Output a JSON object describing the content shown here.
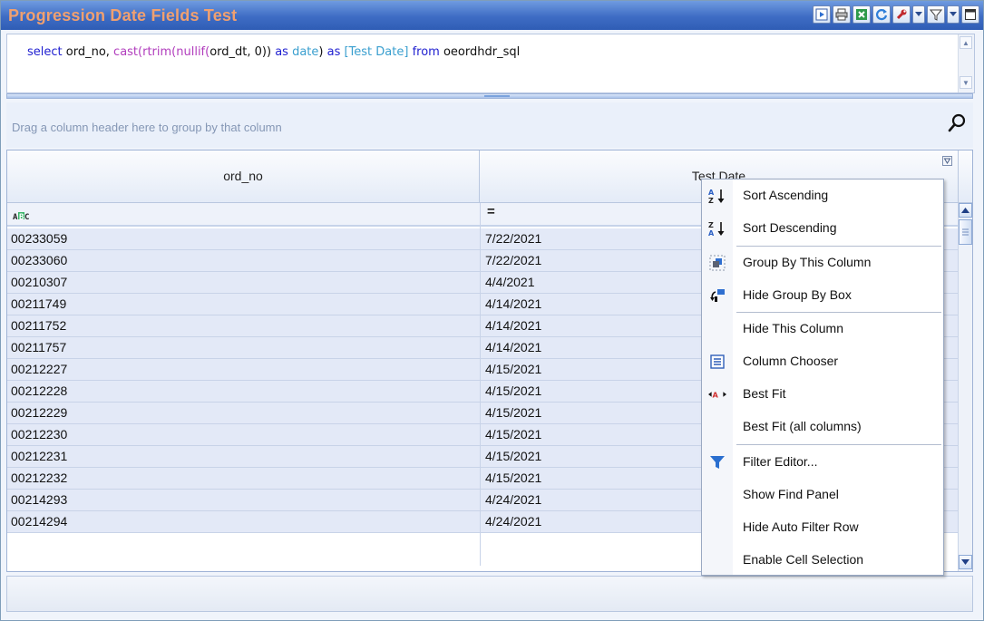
{
  "window": {
    "title": "Progression Date Fields Test"
  },
  "toolbar": {
    "icons": [
      "run-icon",
      "print-icon",
      "excel-export-icon",
      "refresh-icon",
      "settings-wrench-icon",
      "dropdown-arrow-icon",
      "filter-icon",
      "dropdown-arrow-icon",
      "maximize-icon"
    ]
  },
  "sql": {
    "tokens": [
      {
        "text": "select ",
        "color": "blue"
      },
      {
        "text": "ord_no, ",
        "color": "black"
      },
      {
        "text": "cast(rtrim(nullif(",
        "color": "purple"
      },
      {
        "text": "ord_dt, 0)) ",
        "color": "black"
      },
      {
        "text": "as ",
        "color": "blue"
      },
      {
        "text": "date",
        "color": "teal"
      },
      {
        "text": ") ",
        "color": "black"
      },
      {
        "text": "as ",
        "color": "blue"
      },
      {
        "text": "[Test Date] ",
        "color": "teal"
      },
      {
        "text": "from ",
        "color": "blue"
      },
      {
        "text": "oeordhdr_sql",
        "color": "black"
      }
    ]
  },
  "group_panel": {
    "hint": "Drag a column header here to group by that column"
  },
  "grid": {
    "columns": [
      {
        "header": "ord_no",
        "filter_icon": "abc-filter-icon"
      },
      {
        "header": "Test Date",
        "filter_icon": "equals-filter-icon",
        "filter_symbol": "="
      }
    ],
    "rows": [
      [
        "00233059",
        "7/22/2021"
      ],
      [
        "00233060",
        "7/22/2021"
      ],
      [
        "00210307",
        "4/4/2021"
      ],
      [
        "00211749",
        "4/14/2021"
      ],
      [
        "00211752",
        "4/14/2021"
      ],
      [
        "00211757",
        "4/14/2021"
      ],
      [
        "00212227",
        "4/15/2021"
      ],
      [
        "00212228",
        "4/15/2021"
      ],
      [
        "00212229",
        "4/15/2021"
      ],
      [
        "00212230",
        "4/15/2021"
      ],
      [
        "00212231",
        "4/15/2021"
      ],
      [
        "00212232",
        "4/15/2021"
      ],
      [
        "00214293",
        "4/24/2021"
      ],
      [
        "00214294",
        "4/24/2021"
      ]
    ]
  },
  "context_menu": {
    "items": [
      {
        "label": "Sort Ascending",
        "icon": "sort-ascending-icon"
      },
      {
        "label": "Sort Descending",
        "icon": "sort-descending-icon"
      },
      {
        "label": "Group By This Column",
        "icon": "group-by-column-icon"
      },
      {
        "label": "Hide Group By Box",
        "icon": "group-by-box-icon"
      },
      {
        "label": "Hide This Column",
        "icon": ""
      },
      {
        "label": "Column Chooser",
        "icon": "column-chooser-icon"
      },
      {
        "label": "Best Fit",
        "icon": "best-fit-icon"
      },
      {
        "label": "Best Fit (all columns)",
        "icon": ""
      },
      {
        "label": "Filter Editor...",
        "icon": "funnel-filter-icon"
      },
      {
        "label": "Show Find Panel",
        "icon": ""
      },
      {
        "label": "Hide Auto Filter Row",
        "icon": ""
      },
      {
        "label": "Enable Cell Selection",
        "icon": ""
      }
    ]
  },
  "colors": {
    "title_text": "#f0a070",
    "titlebar": "#3e6cc4",
    "row_background": "#e3e9f7",
    "menu_filter_icon": "#2a6fcf"
  }
}
